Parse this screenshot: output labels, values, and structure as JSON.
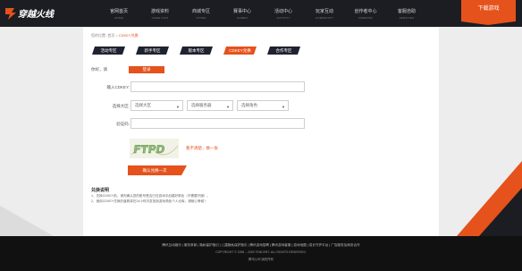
{
  "header": {
    "nav": [
      {
        "cn": "官网首页",
        "en": "HOME"
      },
      {
        "cn": "游戏资料",
        "en": "GAME INFO"
      },
      {
        "cn": "商城专区",
        "en": "STORE"
      },
      {
        "cn": "赛事中心",
        "en": "GAMES"
      },
      {
        "cn": "活动中心",
        "en": "ACTIVITY"
      },
      {
        "cn": "玩家互动",
        "en": "COMMUNITY"
      },
      {
        "cn": "创作者中心",
        "en": "CREATOR"
      },
      {
        "cn": "客服自助",
        "en": "SERVICES"
      }
    ],
    "download_label": "下载游戏"
  },
  "breadcrumb": {
    "prefix": "您的位置: 首页 > ",
    "current": "CDKEY兑换"
  },
  "tabs": [
    {
      "label": "活动专区",
      "active": false
    },
    {
      "label": "新手专区",
      "active": false
    },
    {
      "label": "版本专区",
      "active": false
    },
    {
      "label": "CDKEY兑换",
      "active": true
    },
    {
      "label": "合作专区",
      "active": false
    }
  ],
  "form": {
    "greeting": "你好，请",
    "login_label": "登录",
    "cdkey_label": "输入CDKEY:",
    "cdkey_value": "",
    "region_label": "选择大区:",
    "region_selects": [
      "选择大区",
      "选择服务器",
      "选择角色"
    ],
    "captcha_label": "验证码:",
    "captcha_value": "",
    "captcha_text": "FTPD",
    "captcha_refresh": "看不清楚，换一张",
    "submit_label": "确认兑换一次"
  },
  "notes": {
    "title": "兑换说明",
    "items": [
      "1、兑换CDKEY前，请先确认您的账号是否已在游戏中创建好角色（不需要开服）。",
      "2、使用CDKEY兑换的道具将在24小时内发放到游戏角色个人仓库，请耐心等候！"
    ]
  },
  "footer": {
    "links": [
      "腾讯互动娱乐",
      "服务条款",
      "隐私保护指引",
      "儿童隐私保护指引",
      "腾讯游戏招聘",
      "腾讯游戏客服",
      "游戏地图",
      "成长守护平台",
      "广告服务及商务合作"
    ],
    "copyright": "COPYRIGHT © 1998 – 2025 TENCENT. ALL RIGHTS RESERVED.",
    "company": "腾讯公司 版权所有"
  },
  "colors": {
    "accent": "#e5521c",
    "dark": "#1b1d22",
    "tab": "#1f2230"
  }
}
